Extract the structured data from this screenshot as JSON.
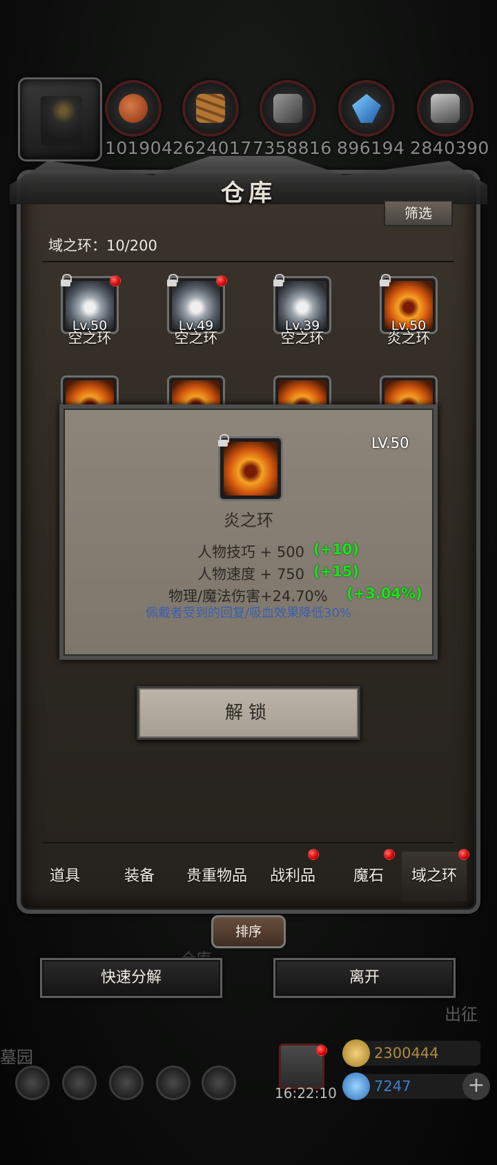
{
  "resources": [
    {
      "icon": "meat-icon",
      "value": "101904",
      "color": "#b4522a"
    },
    {
      "icon": "wood-icon",
      "value": "2624017",
      "color": "#a0652a"
    },
    {
      "icon": "stone-icon",
      "value": "7358816",
      "color": "#6b6b6b"
    },
    {
      "icon": "crystal-icon",
      "value": "896194",
      "color": "#3b87d6"
    },
    {
      "icon": "iron-icon",
      "value": "2840390",
      "color": "#8a8a8a"
    }
  ],
  "window": {
    "title": "仓库",
    "filter_label": "筛选"
  },
  "count": {
    "label": "域之环：",
    "value": "10/200"
  },
  "items": [
    {
      "level": "Lv.50",
      "name": "空之环",
      "type": "sky"
    },
    {
      "level": "Lv.49",
      "name": "空之环",
      "type": "sky"
    },
    {
      "level": "Lv.39",
      "name": "空之环",
      "type": "sky"
    },
    {
      "level": "Lv.50",
      "name": "炎之环",
      "type": "fire"
    }
  ],
  "tooltip": {
    "level": "LV.50",
    "name": "炎之环",
    "stats": [
      {
        "text": "人物技巧 + 500",
        "bonus": "(+10)"
      },
      {
        "text": "人物速度 + 750",
        "bonus": "(+15)"
      },
      {
        "text": "物理/魔法伤害+24.70%",
        "bonus": "(+3.04%)"
      }
    ],
    "note": "佩戴者受到的回复/吸血效果降低30%"
  },
  "unlock_label": "解锁",
  "tabs": [
    "道具",
    "装备",
    "贵重物品",
    "战利品",
    "魔石",
    "域之环"
  ],
  "sort_label": "排序",
  "actions": {
    "decompose": "快速分解",
    "leave": "离开"
  },
  "background": {
    "left_label": "墓园",
    "right_label": "出征",
    "warehouse_label": "仓库"
  },
  "hud": {
    "time": "16:22:10",
    "gold": "2300444",
    "gems": "7247"
  },
  "colors": {
    "bonus_green": "#1ce01c",
    "note_blue": "#3a5fb0",
    "badge_red": "#d80000",
    "gold": "#c0a050",
    "gem": "#3d7fd0"
  }
}
